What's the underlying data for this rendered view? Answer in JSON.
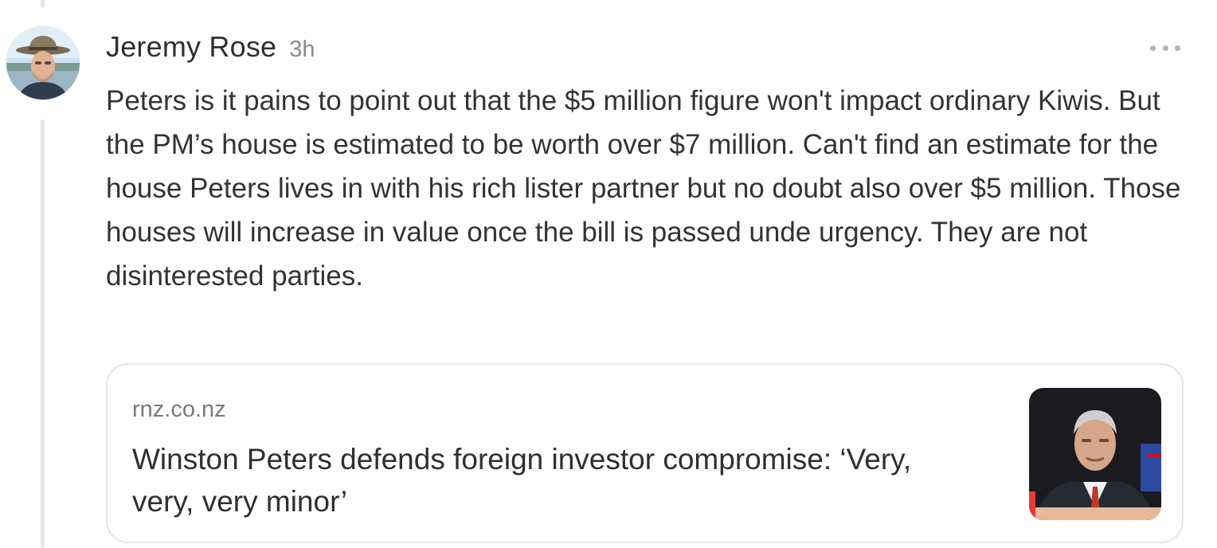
{
  "comment": {
    "author": "Jeremy Rose",
    "time": "3h",
    "more_label": "More options",
    "text": "Peters is it pains to point out that the $5 million figure won't impact ordinary Kiwis. But the PM’s house is estimated to be worth over $7 million. Can't find an estimate for the house Peters lives in with his rich lister partner but no doubt also over $5 million. Those houses will increase in value once the bill is passed unde urgency. They are not disinterested parties."
  },
  "link_card": {
    "domain": "rnz.co.nz",
    "title": "Winston Peters defends foreign investor compromise: ‘Very, very, very minor’"
  },
  "icons": {
    "more": "more-horizontal-icon"
  },
  "colors": {
    "thread_line": "#e6e6e6",
    "card_border": "#e6e6e6",
    "text": "#333333",
    "muted": "#8a8a8a"
  }
}
